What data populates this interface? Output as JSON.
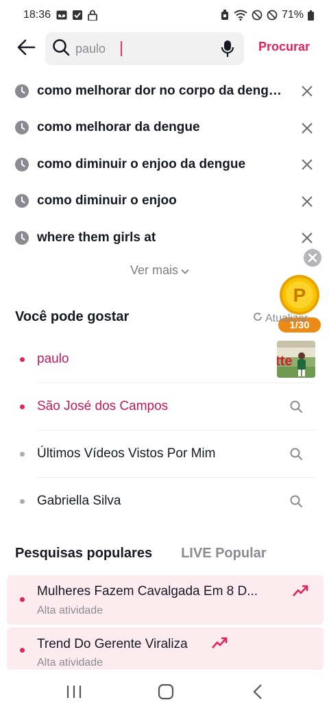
{
  "status_bar": {
    "time": "18:36",
    "battery": "71%"
  },
  "search": {
    "value": "",
    "placeholder": "paulo",
    "submit_label": "Procurar"
  },
  "history": [
    {
      "text": "como melhorar dor no corpo da dengue"
    },
    {
      "text": "como melhorar da dengue"
    },
    {
      "text": "como diminuir o enjoo da dengue"
    },
    {
      "text": "como diminuir o enjoo"
    },
    {
      "text": "where them girls at"
    }
  ],
  "see_more_label": "Ver mais",
  "rewards": {
    "coin_letter": "P",
    "counter": "1/30"
  },
  "suggestions": {
    "title": "Você pode gostar",
    "refresh_label": "Atualizar",
    "items": [
      {
        "text": "paulo",
        "highlight": true
      },
      {
        "text": "São José dos Campos",
        "highlight": true
      },
      {
        "text": "Últimos Vídeos Vistos Por Mim",
        "highlight": false
      },
      {
        "text": "Gabriella Silva",
        "highlight": false
      }
    ]
  },
  "popular": {
    "tabs": [
      "Pesquisas populares",
      "LIVE Popular"
    ],
    "items": [
      {
        "title": "Mulheres Fazem Cavalgada Em 8 D...",
        "subtitle": "Alta atividade"
      },
      {
        "title": "Trend Do Gerente Viraliza",
        "subtitle": "Alta atividade"
      }
    ]
  },
  "colors": {
    "accent": "#e0245e",
    "coin": "#f5b800",
    "counter_bg": "#ec8a16",
    "popular_bg": "#fdecef"
  }
}
